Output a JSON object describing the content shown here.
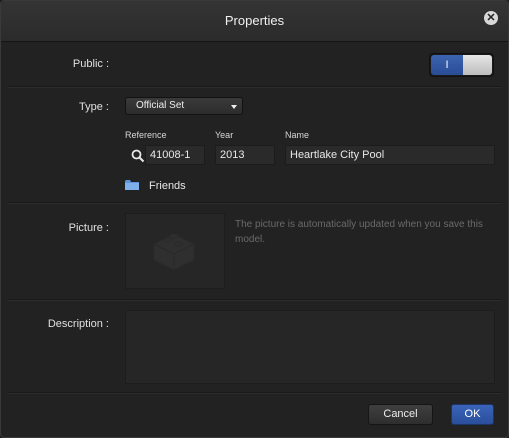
{
  "dialog": {
    "title": "Properties",
    "close_icon": "close-icon"
  },
  "public": {
    "label": "Public :",
    "toggle_on_text": "I",
    "enabled": true,
    "accent": "#2f57a3"
  },
  "type": {
    "label": "Type :",
    "selected": "Official Set"
  },
  "reference": {
    "header": "Reference",
    "value": "41008-1",
    "icon": "search-icon"
  },
  "year": {
    "header": "Year",
    "value": "2013"
  },
  "name": {
    "header": "Name",
    "value": "Heartlake City Pool"
  },
  "theme": {
    "icon": "folder-icon",
    "value": "Friends"
  },
  "picture": {
    "label": "Picture :",
    "note": "The picture is automatically updated when you save this model."
  },
  "description": {
    "label": "Description :",
    "value": ""
  },
  "buttons": {
    "cancel": "Cancel",
    "ok": "OK"
  }
}
